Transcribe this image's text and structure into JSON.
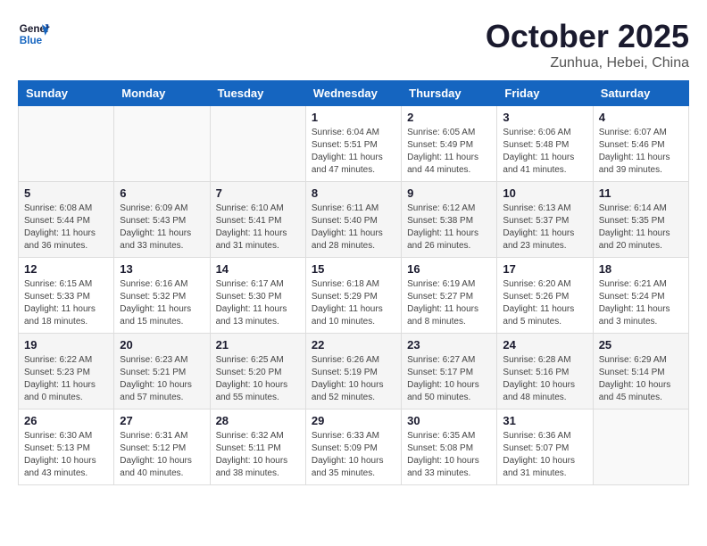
{
  "header": {
    "logo_line1": "General",
    "logo_line2": "Blue",
    "month": "October 2025",
    "location": "Zunhua, Hebei, China"
  },
  "weekdays": [
    "Sunday",
    "Monday",
    "Tuesday",
    "Wednesday",
    "Thursday",
    "Friday",
    "Saturday"
  ],
  "weeks": [
    [
      {
        "day": "",
        "info": ""
      },
      {
        "day": "",
        "info": ""
      },
      {
        "day": "",
        "info": ""
      },
      {
        "day": "1",
        "info": "Sunrise: 6:04 AM\nSunset: 5:51 PM\nDaylight: 11 hours and 47 minutes."
      },
      {
        "day": "2",
        "info": "Sunrise: 6:05 AM\nSunset: 5:49 PM\nDaylight: 11 hours and 44 minutes."
      },
      {
        "day": "3",
        "info": "Sunrise: 6:06 AM\nSunset: 5:48 PM\nDaylight: 11 hours and 41 minutes."
      },
      {
        "day": "4",
        "info": "Sunrise: 6:07 AM\nSunset: 5:46 PM\nDaylight: 11 hours and 39 minutes."
      }
    ],
    [
      {
        "day": "5",
        "info": "Sunrise: 6:08 AM\nSunset: 5:44 PM\nDaylight: 11 hours and 36 minutes."
      },
      {
        "day": "6",
        "info": "Sunrise: 6:09 AM\nSunset: 5:43 PM\nDaylight: 11 hours and 33 minutes."
      },
      {
        "day": "7",
        "info": "Sunrise: 6:10 AM\nSunset: 5:41 PM\nDaylight: 11 hours and 31 minutes."
      },
      {
        "day": "8",
        "info": "Sunrise: 6:11 AM\nSunset: 5:40 PM\nDaylight: 11 hours and 28 minutes."
      },
      {
        "day": "9",
        "info": "Sunrise: 6:12 AM\nSunset: 5:38 PM\nDaylight: 11 hours and 26 minutes."
      },
      {
        "day": "10",
        "info": "Sunrise: 6:13 AM\nSunset: 5:37 PM\nDaylight: 11 hours and 23 minutes."
      },
      {
        "day": "11",
        "info": "Sunrise: 6:14 AM\nSunset: 5:35 PM\nDaylight: 11 hours and 20 minutes."
      }
    ],
    [
      {
        "day": "12",
        "info": "Sunrise: 6:15 AM\nSunset: 5:33 PM\nDaylight: 11 hours and 18 minutes."
      },
      {
        "day": "13",
        "info": "Sunrise: 6:16 AM\nSunset: 5:32 PM\nDaylight: 11 hours and 15 minutes."
      },
      {
        "day": "14",
        "info": "Sunrise: 6:17 AM\nSunset: 5:30 PM\nDaylight: 11 hours and 13 minutes."
      },
      {
        "day": "15",
        "info": "Sunrise: 6:18 AM\nSunset: 5:29 PM\nDaylight: 11 hours and 10 minutes."
      },
      {
        "day": "16",
        "info": "Sunrise: 6:19 AM\nSunset: 5:27 PM\nDaylight: 11 hours and 8 minutes."
      },
      {
        "day": "17",
        "info": "Sunrise: 6:20 AM\nSunset: 5:26 PM\nDaylight: 11 hours and 5 minutes."
      },
      {
        "day": "18",
        "info": "Sunrise: 6:21 AM\nSunset: 5:24 PM\nDaylight: 11 hours and 3 minutes."
      }
    ],
    [
      {
        "day": "19",
        "info": "Sunrise: 6:22 AM\nSunset: 5:23 PM\nDaylight: 11 hours and 0 minutes."
      },
      {
        "day": "20",
        "info": "Sunrise: 6:23 AM\nSunset: 5:21 PM\nDaylight: 10 hours and 57 minutes."
      },
      {
        "day": "21",
        "info": "Sunrise: 6:25 AM\nSunset: 5:20 PM\nDaylight: 10 hours and 55 minutes."
      },
      {
        "day": "22",
        "info": "Sunrise: 6:26 AM\nSunset: 5:19 PM\nDaylight: 10 hours and 52 minutes."
      },
      {
        "day": "23",
        "info": "Sunrise: 6:27 AM\nSunset: 5:17 PM\nDaylight: 10 hours and 50 minutes."
      },
      {
        "day": "24",
        "info": "Sunrise: 6:28 AM\nSunset: 5:16 PM\nDaylight: 10 hours and 48 minutes."
      },
      {
        "day": "25",
        "info": "Sunrise: 6:29 AM\nSunset: 5:14 PM\nDaylight: 10 hours and 45 minutes."
      }
    ],
    [
      {
        "day": "26",
        "info": "Sunrise: 6:30 AM\nSunset: 5:13 PM\nDaylight: 10 hours and 43 minutes."
      },
      {
        "day": "27",
        "info": "Sunrise: 6:31 AM\nSunset: 5:12 PM\nDaylight: 10 hours and 40 minutes."
      },
      {
        "day": "28",
        "info": "Sunrise: 6:32 AM\nSunset: 5:11 PM\nDaylight: 10 hours and 38 minutes."
      },
      {
        "day": "29",
        "info": "Sunrise: 6:33 AM\nSunset: 5:09 PM\nDaylight: 10 hours and 35 minutes."
      },
      {
        "day": "30",
        "info": "Sunrise: 6:35 AM\nSunset: 5:08 PM\nDaylight: 10 hours and 33 minutes."
      },
      {
        "day": "31",
        "info": "Sunrise: 6:36 AM\nSunset: 5:07 PM\nDaylight: 10 hours and 31 minutes."
      },
      {
        "day": "",
        "info": ""
      }
    ]
  ]
}
